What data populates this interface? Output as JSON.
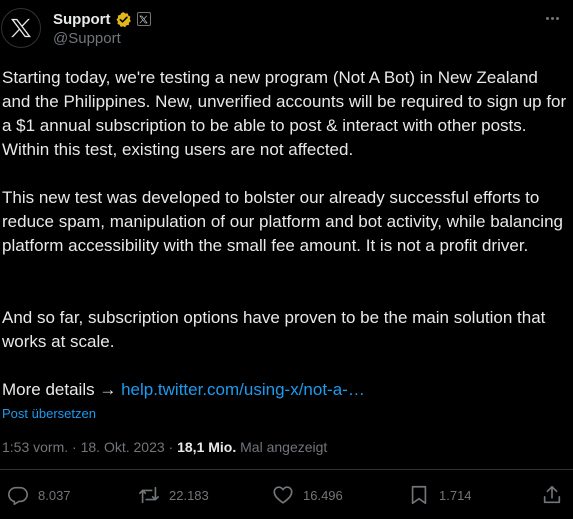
{
  "author": {
    "display_name": "Support",
    "handle": "@Support",
    "avatar_icon": "x-logo-icon",
    "verified_icon": "gold-verified-badge-icon",
    "affiliation_icon": "x-affiliate-badge-icon"
  },
  "tweet": {
    "para1": "Starting today, we're testing a new program (Not A Bot) in New Zealand and the Philippines. New, unverified accounts will be required to sign up for a $1 annual subscription to be able to post & interact with other posts. Within this test, existing users are not affected.",
    "para2": "This new test was developed to bolster our already successful efforts to reduce spam, manipulation of our platform and bot activity, while balancing platform accessibility with the small fee amount. It is not a profit driver.",
    "para3": "And so far, subscription options have proven to be the main solution that works at scale.",
    "more_details_prefix": "More details →",
    "link_text": "help.twitter.com/using-x/not-a-…"
  },
  "translate_label": "Post übersetzen",
  "meta": {
    "time": "1:53 vorm.",
    "separator": "·",
    "date": "18. Okt. 2023",
    "views_count": "18,1 Mio.",
    "views_label": "Mal angezeigt"
  },
  "actions": {
    "replies": "8.037",
    "reposts": "22.183",
    "likes": "16.496",
    "bookmarks": "1.714"
  },
  "colors": {
    "background": "#000000",
    "text": "#e7e9ea",
    "muted": "#71767b",
    "link": "#1d9bf0",
    "verified_gold": "#e2b719"
  }
}
